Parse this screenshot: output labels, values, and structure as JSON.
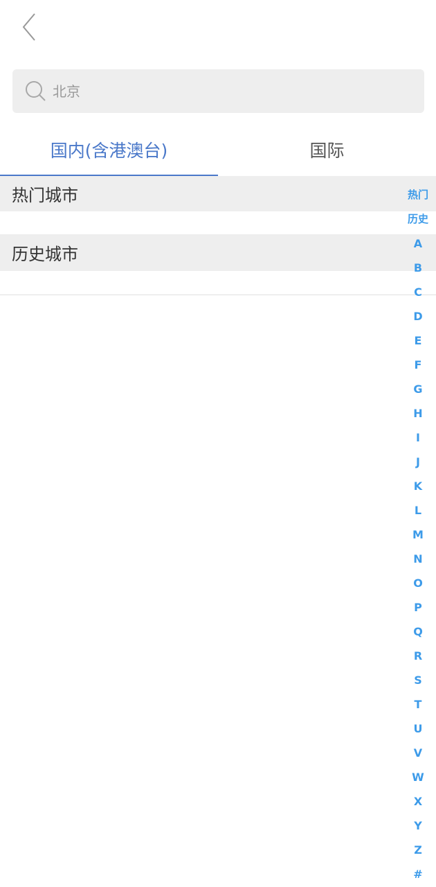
{
  "search": {
    "placeholder": "北京"
  },
  "tabs": [
    {
      "label": "国内(含港澳台)",
      "active": true
    },
    {
      "label": "国际",
      "active": false
    }
  ],
  "sections": {
    "hot": "热门城市",
    "history": "历史城市"
  },
  "index_bar": [
    "热门",
    "历史",
    "A",
    "B",
    "C",
    "D",
    "E",
    "F",
    "G",
    "H",
    "I",
    "J",
    "K",
    "L",
    "M",
    "N",
    "O",
    "P",
    "Q",
    "R",
    "S",
    "T",
    "U",
    "V",
    "W",
    "X",
    "Y",
    "Z",
    "#"
  ],
  "colors": {
    "accent": "#4a78c9",
    "index": "#3d9be9",
    "section_bg": "#eeeeee"
  }
}
